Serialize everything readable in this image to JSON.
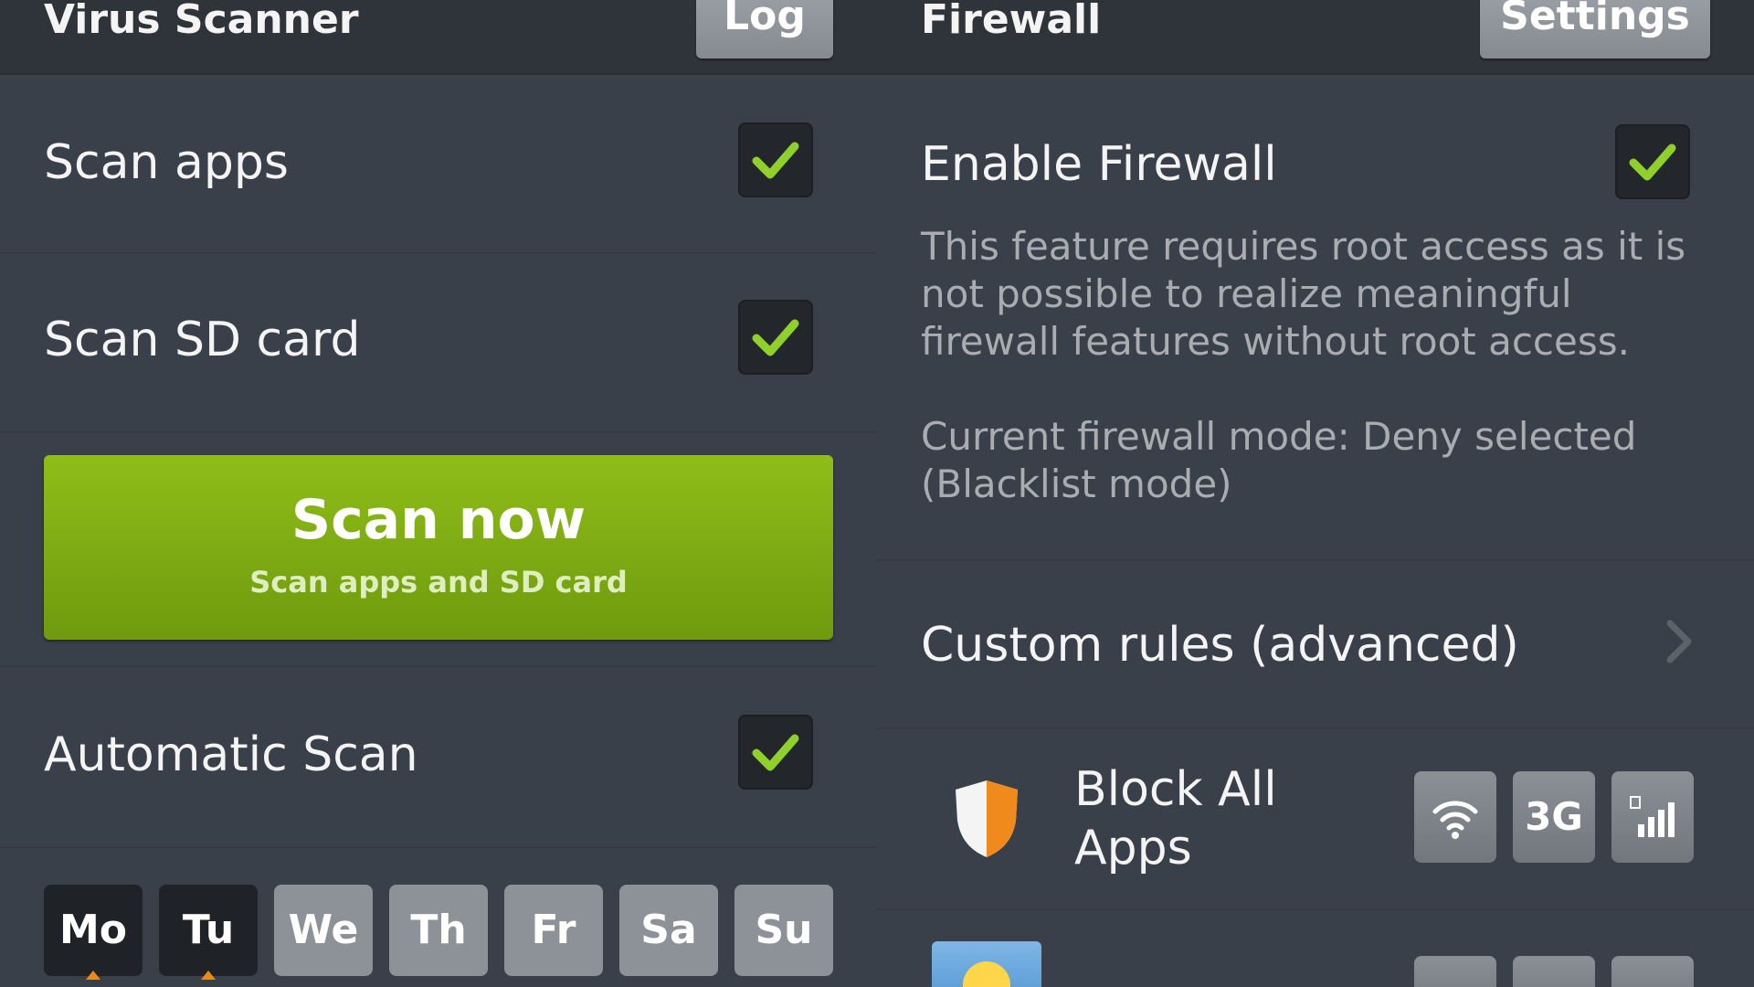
{
  "left": {
    "title": "Virus Scanner",
    "log_label": "Log",
    "scan_apps_label": "Scan apps",
    "scan_sd_label": "Scan SD card",
    "scan_button": {
      "title": "Scan now",
      "subtitle": "Scan apps and SD card"
    },
    "auto_scan_label": "Automatic Scan",
    "days": [
      {
        "label": "Mo",
        "selected": true
      },
      {
        "label": "Tu",
        "selected": true
      },
      {
        "label": "We",
        "selected": false
      },
      {
        "label": "Th",
        "selected": false
      },
      {
        "label": "Fr",
        "selected": false
      },
      {
        "label": "Sa",
        "selected": false
      },
      {
        "label": "Su",
        "selected": false
      }
    ]
  },
  "right": {
    "title": "Firewall",
    "settings_label": "Settings",
    "enable_label": "Enable Firewall",
    "description": "This feature requires root access as it is not possible to realize meaningful firewall features without root access.",
    "mode_text": "Current firewall mode: Deny selected (Blacklist mode)",
    "custom_rules_label": "Custom rules (advanced)",
    "block_all_label": "Block All Apps",
    "net_buttons": [
      "wifi-icon",
      "3G",
      "roaming-signal-icon"
    ]
  },
  "colors": {
    "accent_green": "#8fbd18",
    "check_green": "#8fd12a",
    "shield_orange": "#f08a1c"
  }
}
